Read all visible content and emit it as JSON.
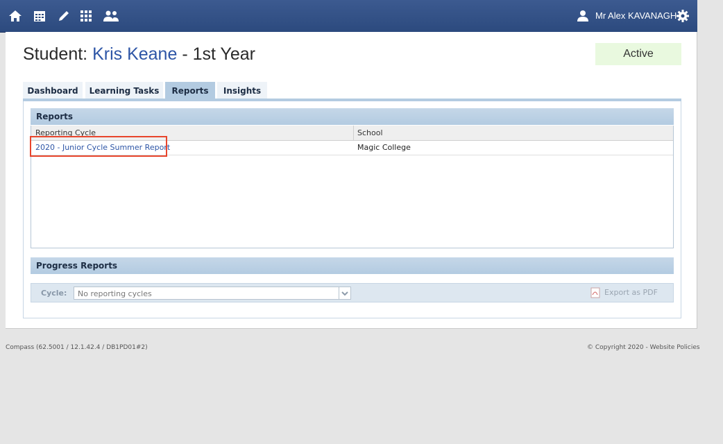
{
  "header": {
    "nav_icons": [
      "home-icon",
      "calendar-icon",
      "pencil-icon",
      "apps-grid-icon",
      "people-icon"
    ],
    "user_name": "Mr Alex KAVANAGH",
    "accent": "#2c4a7e"
  },
  "page": {
    "title_prefix": "Student: ",
    "student_name": "Kris Keane",
    "title_suffix": " - 1st Year",
    "status": "Active"
  },
  "tabs": [
    {
      "label": "Dashboard",
      "active": false
    },
    {
      "label": "Learning Tasks",
      "active": false
    },
    {
      "label": "Reports",
      "active": true
    },
    {
      "label": "Insights",
      "active": false
    }
  ],
  "reports": {
    "section_title": "Reports",
    "columns": [
      "Reporting Cycle",
      "School"
    ],
    "rows": [
      {
        "cycle": "2020 - Junior Cycle Summer Report",
        "school": "Magic College"
      }
    ]
  },
  "progress_reports": {
    "section_title": "Progress Reports",
    "cycle_label": "Cycle:",
    "cycle_value": "No reporting cycles",
    "export_label": "Export as PDF"
  },
  "footer": {
    "version": "Compass (62.5001 / 12.1.42.4 / DB1PD01#2)",
    "copyright": "© Copyright 2020 - Website Policies"
  }
}
